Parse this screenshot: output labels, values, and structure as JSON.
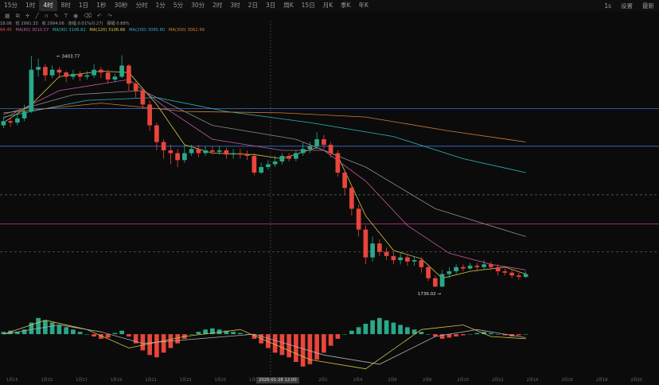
{
  "toolbar": {
    "timeframes": [
      "15分",
      "1时",
      "4时",
      "8时",
      "1日",
      "1秒",
      "30秒",
      "分时",
      "1分",
      "5分",
      "30分",
      "2时",
      "3时",
      "2日",
      "3日",
      "周K",
      "15日",
      "月K",
      "季K",
      "年K"
    ],
    "active_index": 2,
    "right": {
      "interval": "1s",
      "settings": "设置",
      "fullscreen": "最新"
    }
  },
  "legend": {
    "line1": [
      "18.06",
      "低 2991.33",
      "收 2994.06",
      "涨幅 0.01%(0.27)",
      "振幅 0.88%"
    ],
    "line2": [
      "84.45",
      "MA(60) 3010.57",
      "MA(90) 3106.82",
      "MA(120) 3106.66",
      "MA(200) 3085.80",
      "MA(300) 3062.99"
    ]
  },
  "annotations": {
    "high": "3403.77",
    "low": "1736.02"
  },
  "x_axis": {
    "labels": [
      "1月15",
      "1月15",
      "1月17",
      "1月19",
      "1月21",
      "1月23",
      "1月25",
      "1月27",
      "1月31",
      "2月2",
      "2月4",
      "2月6",
      "2月8",
      "2月10",
      "2月12",
      "2月14",
      "2月16",
      "2月18",
      "2月20"
    ],
    "crosshair_time": "2026-01-28 12:00"
  },
  "colors": {
    "up": "#2aa889",
    "down": "#e8453c",
    "bg": "#0b0b0b",
    "ma_yellow": "#d8c54a",
    "ma_pink": "#c35aa4",
    "ma_teal": "#2fb6b6",
    "ma_orange": "#d97b32",
    "ma_blue": "#3b6fd4",
    "line_magenta": "#d0309a"
  },
  "chart_data": {
    "type": "candlestick",
    "y_range": [
      1650,
      3550
    ],
    "candles": [
      [
        2900,
        2930,
        2960,
        2880
      ],
      [
        2930,
        2920,
        2950,
        2890
      ],
      [
        2920,
        2950,
        2980,
        2900
      ],
      [
        2950,
        3000,
        3050,
        2930
      ],
      [
        3000,
        3300,
        3400,
        2990
      ],
      [
        3300,
        3320,
        3380,
        3250
      ],
      [
        3320,
        3260,
        3340,
        3220
      ],
      [
        3260,
        3300,
        3330,
        3240
      ],
      [
        3300,
        3280,
        3320,
        3240
      ],
      [
        3280,
        3250,
        3290,
        3210
      ],
      [
        3250,
        3270,
        3300,
        3230
      ],
      [
        3270,
        3250,
        3290,
        3220
      ],
      [
        3250,
        3260,
        3290,
        3230
      ],
      [
        3260,
        3300,
        3340,
        3240
      ],
      [
        3300,
        3280,
        3320,
        3240
      ],
      [
        3280,
        3230,
        3300,
        3200
      ],
      [
        3230,
        3250,
        3270,
        3210
      ],
      [
        3250,
        3330,
        3404,
        3240
      ],
      [
        3330,
        3200,
        3340,
        3150
      ],
      [
        3200,
        3150,
        3230,
        3100
      ],
      [
        3150,
        3050,
        3170,
        3020
      ],
      [
        3050,
        2900,
        3080,
        2860
      ],
      [
        2900,
        2780,
        2920,
        2720
      ],
      [
        2780,
        2720,
        2800,
        2660
      ],
      [
        2720,
        2700,
        2760,
        2620
      ],
      [
        2700,
        2650,
        2730,
        2600
      ],
      [
        2650,
        2700,
        2760,
        2630
      ],
      [
        2700,
        2730,
        2760,
        2680
      ],
      [
        2730,
        2700,
        2760,
        2670
      ],
      [
        2700,
        2720,
        2750,
        2680
      ],
      [
        2720,
        2710,
        2750,
        2690
      ],
      [
        2710,
        2720,
        2750,
        2690
      ],
      [
        2720,
        2690,
        2740,
        2660
      ],
      [
        2690,
        2700,
        2730,
        2660
      ],
      [
        2700,
        2690,
        2730,
        2660
      ],
      [
        2690,
        2680,
        2720,
        2650
      ],
      [
        2680,
        2560,
        2700,
        2540
      ],
      [
        2560,
        2600,
        2630,
        2550
      ],
      [
        2600,
        2620,
        2650,
        2580
      ],
      [
        2620,
        2640,
        2680,
        2600
      ],
      [
        2640,
        2680,
        2700,
        2620
      ],
      [
        2680,
        2660,
        2700,
        2640
      ],
      [
        2660,
        2700,
        2720,
        2640
      ],
      [
        2700,
        2730,
        2780,
        2680
      ],
      [
        2730,
        2750,
        2780,
        2700
      ],
      [
        2750,
        2800,
        2850,
        2730
      ],
      [
        2800,
        2760,
        2830,
        2730
      ],
      [
        2760,
        2700,
        2780,
        2670
      ],
      [
        2700,
        2560,
        2720,
        2530
      ],
      [
        2560,
        2450,
        2580,
        2400
      ],
      [
        2450,
        2300,
        2470,
        2250
      ],
      [
        2300,
        2150,
        2330,
        2100
      ],
      [
        2150,
        1950,
        2180,
        1900
      ],
      [
        1950,
        2050,
        2100,
        1920
      ],
      [
        2050,
        1990,
        2080,
        1960
      ],
      [
        1990,
        1960,
        2020,
        1930
      ],
      [
        1960,
        1930,
        1990,
        1900
      ],
      [
        1930,
        1950,
        1980,
        1900
      ],
      [
        1950,
        1920,
        1970,
        1890
      ],
      [
        1920,
        1930,
        1960,
        1890
      ],
      [
        1930,
        1880,
        1950,
        1840
      ],
      [
        1880,
        1800,
        1900,
        1780
      ],
      [
        1800,
        1740,
        1820,
        1736
      ],
      [
        1740,
        1830,
        1860,
        1736
      ],
      [
        1830,
        1850,
        1880,
        1800
      ],
      [
        1850,
        1880,
        1900,
        1830
      ],
      [
        1880,
        1870,
        1900,
        1850
      ],
      [
        1870,
        1890,
        1910,
        1860
      ],
      [
        1890,
        1880,
        1910,
        1850
      ],
      [
        1880,
        1900,
        1930,
        1860
      ],
      [
        1900,
        1880,
        1920,
        1860
      ],
      [
        1880,
        1850,
        1900,
        1820
      ],
      [
        1850,
        1840,
        1870,
        1820
      ],
      [
        1840,
        1820,
        1860,
        1800
      ],
      [
        1820,
        1810,
        1840,
        1790
      ],
      [
        1810,
        1830,
        1850,
        1800
      ]
    ],
    "moving_averages": [
      {
        "label": "MA yellow",
        "color": "#d8c54a",
        "values": [
          [
            0,
            2920
          ],
          [
            4,
            3050
          ],
          [
            8,
            3250
          ],
          [
            14,
            3290
          ],
          [
            18,
            3280
          ],
          [
            22,
            3050
          ],
          [
            26,
            2760
          ],
          [
            30,
            2700
          ],
          [
            36,
            2690
          ],
          [
            40,
            2660
          ],
          [
            45,
            2740
          ],
          [
            48,
            2680
          ],
          [
            52,
            2250
          ],
          [
            56,
            2000
          ],
          [
            60,
            1940
          ],
          [
            63,
            1800
          ],
          [
            67,
            1850
          ],
          [
            72,
            1880
          ],
          [
            75,
            1830
          ]
        ]
      },
      {
        "label": "MA pink",
        "color": "#c35aa4",
        "values": [
          [
            0,
            2950
          ],
          [
            8,
            3150
          ],
          [
            18,
            3230
          ],
          [
            24,
            3000
          ],
          [
            30,
            2800
          ],
          [
            40,
            2720
          ],
          [
            46,
            2720
          ],
          [
            52,
            2500
          ],
          [
            58,
            2180
          ],
          [
            64,
            1980
          ],
          [
            70,
            1900
          ],
          [
            75,
            1860
          ]
        ]
      },
      {
        "label": "MA gray",
        "color": "#8f8f8f",
        "values": [
          [
            0,
            2980
          ],
          [
            10,
            3120
          ],
          [
            20,
            3150
          ],
          [
            30,
            2900
          ],
          [
            42,
            2800
          ],
          [
            52,
            2600
          ],
          [
            62,
            2300
          ],
          [
            75,
            2100
          ]
        ]
      },
      {
        "label": "MA teal",
        "color": "#2fb6b6",
        "values": [
          [
            0,
            2960
          ],
          [
            12,
            3080
          ],
          [
            22,
            3100
          ],
          [
            32,
            3000
          ],
          [
            44,
            2920
          ],
          [
            56,
            2820
          ],
          [
            66,
            2660
          ],
          [
            75,
            2560
          ]
        ]
      },
      {
        "label": "MA orange",
        "color": "#d97b32",
        "values": [
          [
            0,
            2990
          ],
          [
            14,
            3060
          ],
          [
            26,
            3000
          ],
          [
            40,
            2990
          ],
          [
            52,
            2960
          ],
          [
            64,
            2860
          ],
          [
            75,
            2780
          ]
        ]
      }
    ],
    "horizontal_lines": [
      {
        "price": 3020,
        "color": "#3b6fd4",
        "style": "solid"
      },
      {
        "price": 2750,
        "color": "#3b6fd4",
        "style": "solid"
      },
      {
        "price": 2400,
        "color": "#5a5a5a",
        "style": "dashed"
      },
      {
        "price": 2190,
        "color": "#d0309a",
        "style": "solid"
      },
      {
        "price": 1990,
        "color": "#5a5a5a",
        "style": "dashed"
      }
    ],
    "macd_histogram": [
      2,
      3,
      2,
      4,
      10,
      14,
      12,
      10,
      8,
      6,
      4,
      2,
      0,
      -2,
      -4,
      -3,
      1,
      3,
      -2,
      -8,
      -14,
      -18,
      -20,
      -16,
      -12,
      -8,
      -4,
      0,
      2,
      4,
      5,
      4,
      3,
      2,
      1,
      0,
      -4,
      -8,
      -12,
      -16,
      -18,
      -20,
      -24,
      -28,
      -26,
      -22,
      -16,
      -10,
      -4,
      0,
      3,
      6,
      9,
      12,
      14,
      12,
      10,
      8,
      6,
      4,
      2,
      0,
      -2,
      -4,
      -3,
      -2,
      -1,
      0,
      1,
      2,
      1,
      0,
      -1,
      -2,
      -1,
      0
    ],
    "macd_lines": [
      {
        "color": "#d8c54a",
        "values": [
          [
            0,
            0
          ],
          [
            6,
            12
          ],
          [
            12,
            4
          ],
          [
            18,
            -12
          ],
          [
            26,
            -2
          ],
          [
            34,
            4
          ],
          [
            44,
            -22
          ],
          [
            52,
            -30
          ],
          [
            60,
            4
          ],
          [
            66,
            8
          ],
          [
            70,
            -2
          ],
          [
            75,
            -4
          ]
        ]
      },
      {
        "color": "#b0b0b0",
        "values": [
          [
            0,
            0
          ],
          [
            8,
            8
          ],
          [
            14,
            2
          ],
          [
            20,
            -8
          ],
          [
            28,
            -4
          ],
          [
            36,
            0
          ],
          [
            46,
            -18
          ],
          [
            54,
            -26
          ],
          [
            62,
            -2
          ],
          [
            68,
            4
          ],
          [
            72,
            0
          ],
          [
            75,
            -3
          ]
        ]
      }
    ],
    "macd_range": [
      -35,
      20
    ]
  }
}
